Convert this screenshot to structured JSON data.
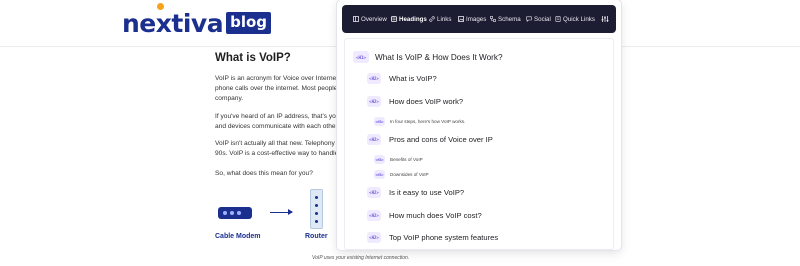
{
  "blog": {
    "logo_word": "nextiva",
    "logo_tag": "blog",
    "article": {
      "heading": "What is VoIP?",
      "p1": [
        "VoIP is an acronym for Voice over Internet Protocol.",
        "phone calls over the internet. Most people",
        "company."
      ],
      "p2": [
        "If you've heard of an IP address, that's you",
        "and devices communicate with each other"
      ],
      "p3": [
        "VoIP isn't actually all that new. Telephony",
        "90s. VoIP is a cost-effective way to handle"
      ],
      "p4": "So, what does this mean for you?"
    },
    "diagram": {
      "modem_label": "Cable Modem",
      "router_label": "Router",
      "caption": "VoIP uses your existing Internet connection."
    }
  },
  "popup": {
    "tabs": [
      {
        "label": "Overview",
        "icon": "overview-icon"
      },
      {
        "label": "Headings",
        "icon": "headings-icon",
        "active": true
      },
      {
        "label": "Links",
        "icon": "link-icon"
      },
      {
        "label": "Images",
        "icon": "image-icon"
      },
      {
        "label": "Schema",
        "icon": "schema-icon"
      },
      {
        "label": "Social",
        "icon": "social-icon"
      },
      {
        "label": "Quick Links",
        "icon": "quick-links-icon"
      },
      {
        "label": "",
        "icon": "settings-sliders-icon"
      }
    ],
    "headings": [
      {
        "level": "H1",
        "tag": "<H1>",
        "text": "What Is VoIP & How Does It Work?"
      },
      {
        "level": "H2",
        "tag": "<H2>",
        "text": "What is VoIP?"
      },
      {
        "level": "H2",
        "tag": "<H2>",
        "text": "How does VoIP work?"
      },
      {
        "level": "H3",
        "tag": "<H3>",
        "text": "In four steps, here's how VoIP works."
      },
      {
        "level": "H2",
        "tag": "<H2>",
        "text": "Pros and cons of Voice over IP"
      },
      {
        "level": "H3",
        "tag": "<H3>",
        "text": "Benefits of VoIP"
      },
      {
        "level": "H3",
        "tag": "<H3>",
        "text": "Downsides of VoIP"
      },
      {
        "level": "H2",
        "tag": "<H2>",
        "text": "Is it easy to use VoIP?"
      },
      {
        "level": "H2",
        "tag": "<H2>",
        "text": "How much does VoIP cost?"
      },
      {
        "level": "H2",
        "tag": "<H2>",
        "text": "Top VoIP phone system features"
      }
    ]
  },
  "colors": {
    "brand": "#1b2f8f",
    "logo_dot": "#f6a21c",
    "tabbar": "#1c1c33",
    "badge_bg": "#efeaff",
    "badge_text": "#6f58d8"
  }
}
